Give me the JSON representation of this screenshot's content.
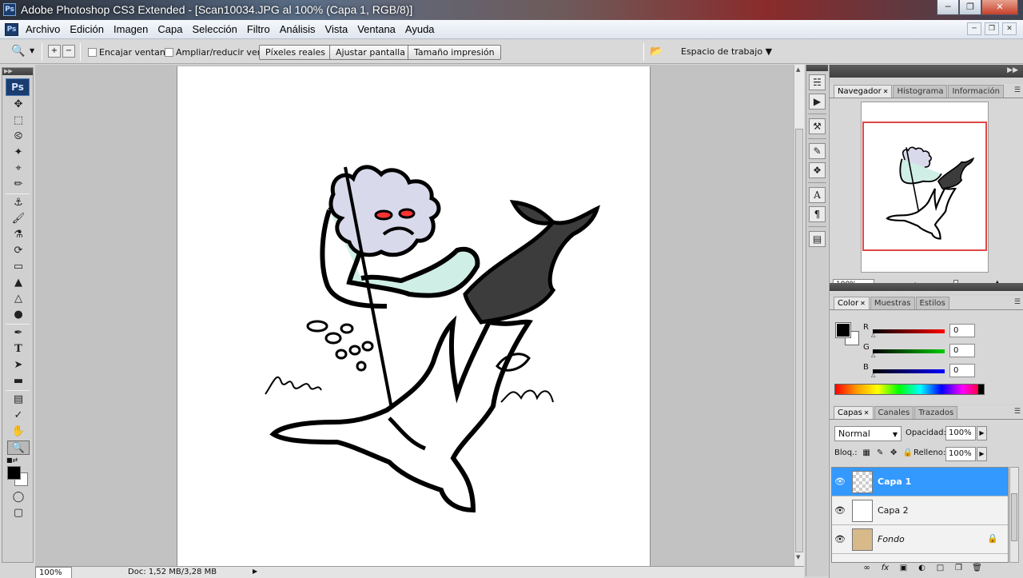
{
  "window": {
    "title": "Adobe Photoshop CS3 Extended - [Scan10034.JPG al 100% (Capa 1, RGB/8)]",
    "app_icon": "Ps",
    "controls": [
      "minimize-icon",
      "restore-icon",
      "close-icon"
    ]
  },
  "menu": {
    "items": [
      "Archivo",
      "Edición",
      "Imagen",
      "Capa",
      "Selección",
      "Filtro",
      "Análisis",
      "Vista",
      "Ventana",
      "Ayuda"
    ]
  },
  "options": {
    "encajar": "Encajar ventana",
    "ampliar": "Ampliar/reducir vent.",
    "pixeles": "Píxeles reales",
    "ajustar": "Ajustar pantalla",
    "tamano": "Tamaño impresión",
    "workspace": "Espacio de trabajo"
  },
  "toolbox": {
    "logo": "Ps",
    "tools": [
      "move-tool",
      "marquee-tool",
      "lasso-tool",
      "magic-wand-tool",
      "crop-tool",
      "slice-tool",
      "healing-brush-tool",
      "brush-tool",
      "clone-stamp-tool",
      "history-brush-tool",
      "eraser-tool",
      "paint-bucket-tool",
      "blur-tool",
      "dodge-tool",
      "pen-tool",
      "type-tool",
      "path-selection-tool",
      "shape-tool",
      "notes-tool",
      "eyedropper-tool",
      "hand-tool",
      "zoom-tool"
    ],
    "selected_tool": "zoom-tool"
  },
  "status": {
    "zoom": "100%",
    "doc": "Doc: 1,52 MB/3,28 MB"
  },
  "navigator": {
    "tabs": [
      "Navegador",
      "Histograma",
      "Información"
    ],
    "zoom": "100%"
  },
  "color": {
    "tabs": [
      "Color",
      "Muestras",
      "Estilos"
    ],
    "r": {
      "label": "R",
      "value": "0",
      "color": "#ff0000"
    },
    "g": {
      "label": "G",
      "value": "0",
      "color": "#00cc00"
    },
    "b": {
      "label": "B",
      "value": "0",
      "color": "#0000ff"
    }
  },
  "layers": {
    "tabs": [
      "Capas",
      "Canales",
      "Trazados"
    ],
    "blend_mode": "Normal",
    "opacity_label": "Opacidad:",
    "opacity": "100%",
    "lock_label": "Bloq.:",
    "fill_label": "Relleno:",
    "fill": "100%",
    "items": [
      {
        "name": "Capa 1",
        "selected": true
      },
      {
        "name": "Capa 2",
        "selected": false
      },
      {
        "name": "Fondo",
        "selected": false
      }
    ]
  }
}
